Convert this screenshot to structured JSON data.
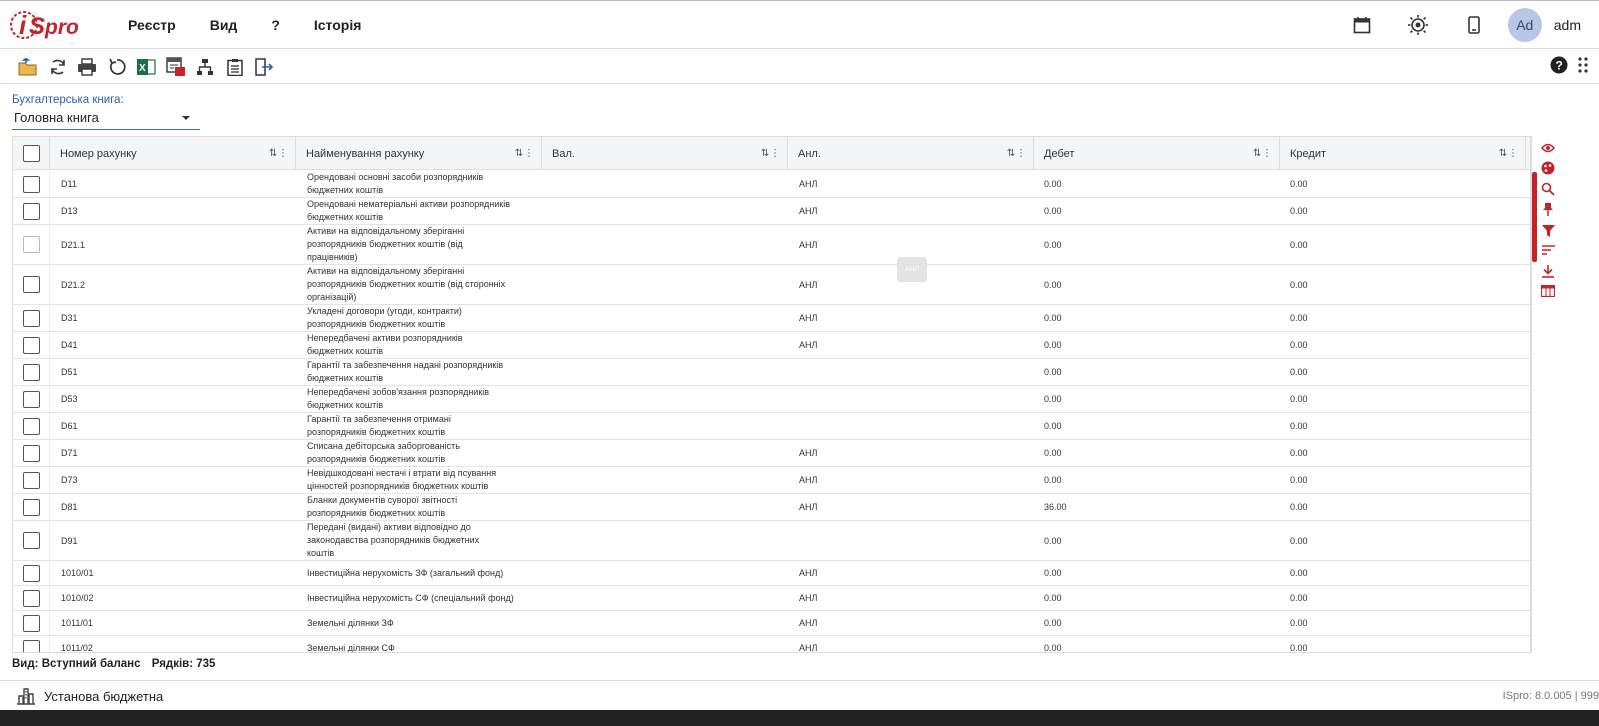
{
  "header": {
    "logo_text": "ISpro",
    "menu": [
      "Реєстр",
      "Вид",
      "?",
      "Історія"
    ],
    "avatar_initials": "Ad",
    "user": "adm",
    "icons": [
      "calendar-icon",
      "settings-sun-icon",
      "mobile-icon"
    ]
  },
  "toolbar": {
    "icons": [
      "open-folder-icon",
      "refresh-icon",
      "print-icon",
      "undo-icon",
      "excel-icon",
      "report-icon",
      "hierarchy-icon",
      "clipboard-icon",
      "exit-icon"
    ],
    "right_icons": [
      "help-icon",
      "apps-grid-icon"
    ]
  },
  "book": {
    "label": "Бухгалтерська книга:",
    "value": "Головна книга"
  },
  "grid": {
    "columns": [
      "Номер рахунку",
      "Найменування рахунку",
      "Вал.",
      "Анл.",
      "Дебет",
      "Кредит"
    ],
    "rows": [
      {
        "num": "D11",
        "name": "Орендовані основні засоби розпорядників\nбюджетних коштів",
        "anl": "АНЛ",
        "deb": "0.00",
        "cred": "0.00",
        "h": 27
      },
      {
        "num": "D13",
        "name": "Орендовані нематеріальні активи розпорядників\nбюджетних коштів",
        "anl": "АНЛ",
        "deb": "0.00",
        "cred": "0.00",
        "h": 27
      },
      {
        "num": "D21.1",
        "name": "Активи на відповідальному зберіганні\nрозпорядників бюджетних коштів (від\nпрацівників)",
        "anl": "АНЛ",
        "deb": "0.00",
        "cred": "0.00",
        "h": 40,
        "dim": true
      },
      {
        "num": "D21.2",
        "name": "Активи на відповідальному зберіганні\nрозпорядників бюджетних коштів (від сторонніх\nорганізацій)",
        "anl": "АНЛ",
        "deb": "0.00",
        "cred": "0.00",
        "h": 40
      },
      {
        "num": "D31",
        "name": "Укладені договори (угоди, контракти)\nрозпорядників бюджетних коштів",
        "anl": "АНЛ",
        "deb": "0.00",
        "cred": "0.00",
        "h": 27
      },
      {
        "num": "D41",
        "name": "Непередбачені активи розпорядників\nбюджетних коштів",
        "anl": "АНЛ",
        "deb": "0.00",
        "cred": "0.00",
        "h": 27
      },
      {
        "num": "D51",
        "name": "Гарантії та забезпечення надані розпорядників\nбюджетних коштів",
        "anl": "",
        "deb": "0.00",
        "cred": "0.00",
        "h": 27
      },
      {
        "num": "D53",
        "name": "Непередбачені зобов'язання розпорядників\nбюджетних коштів",
        "anl": "",
        "deb": "0.00",
        "cred": "0.00",
        "h": 27
      },
      {
        "num": "D61",
        "name": "Гарантії та забезпечення отримані\nрозпорядників бюджетних коштів",
        "anl": "",
        "deb": "0.00",
        "cred": "0.00",
        "h": 27
      },
      {
        "num": "D71",
        "name": "Списана дебіторська заборгованість\nрозпорядників бюджетних коштів",
        "anl": "АНЛ",
        "deb": "0.00",
        "cred": "0.00",
        "h": 27
      },
      {
        "num": "D73",
        "name": "Невідшкодовані нестачі і втрати від псування\nцінностей розпорядників бюджетних коштів",
        "anl": "АНЛ",
        "deb": "0.00",
        "cred": "0.00",
        "h": 27
      },
      {
        "num": "D81",
        "name": "Бланки документів суворої звітності\nрозпорядників бюджетних коштів",
        "anl": "АНЛ",
        "deb": "36.00",
        "cred": "0.00",
        "h": 27
      },
      {
        "num": "D91",
        "name": "Передані (видані) активи відповідно до\nзаконодавства розпорядників бюджетних\nкоштів",
        "anl": "",
        "deb": "0.00",
        "cred": "0.00",
        "h": 40
      },
      {
        "num": "1010/01",
        "name": "Інвестиційна нерухомість ЗФ (загальний фонд)",
        "anl": "АНЛ",
        "deb": "0.00",
        "cred": "0.00",
        "h": 25
      },
      {
        "num": "1010/02",
        "name": "Інвестиційна нерухомість СФ (спеціальний фонд)",
        "anl": "АНЛ",
        "deb": "0.00",
        "cred": "0.00",
        "h": 25
      },
      {
        "num": "1011/01",
        "name": "Земельні ділянки ЗФ",
        "anl": "АНЛ",
        "deb": "0.00",
        "cred": "0.00",
        "h": 25
      },
      {
        "num": "1011/02",
        "name": "Земельні ділянки СФ",
        "anl": "АНЛ",
        "deb": "0.00",
        "cred": "0.00",
        "h": 25
      }
    ],
    "tooltip": "АНЛ"
  },
  "side_icons": [
    "eye-icon",
    "palette-icon",
    "search-icon",
    "pin-icon",
    "filter-icon",
    "sort-lines-icon",
    "download-icon",
    "table-icon"
  ],
  "status": {
    "view": "Вид: Вступний баланс",
    "rows": "Рядків: 735"
  },
  "footer": {
    "org": "Установа бюджетна",
    "version": "ISpro: 8.0.005 | 999"
  },
  "colors": {
    "accent": "#c5232a",
    "link_blue": "#2a63a8",
    "avatar_bg": "#b9c7e6"
  }
}
